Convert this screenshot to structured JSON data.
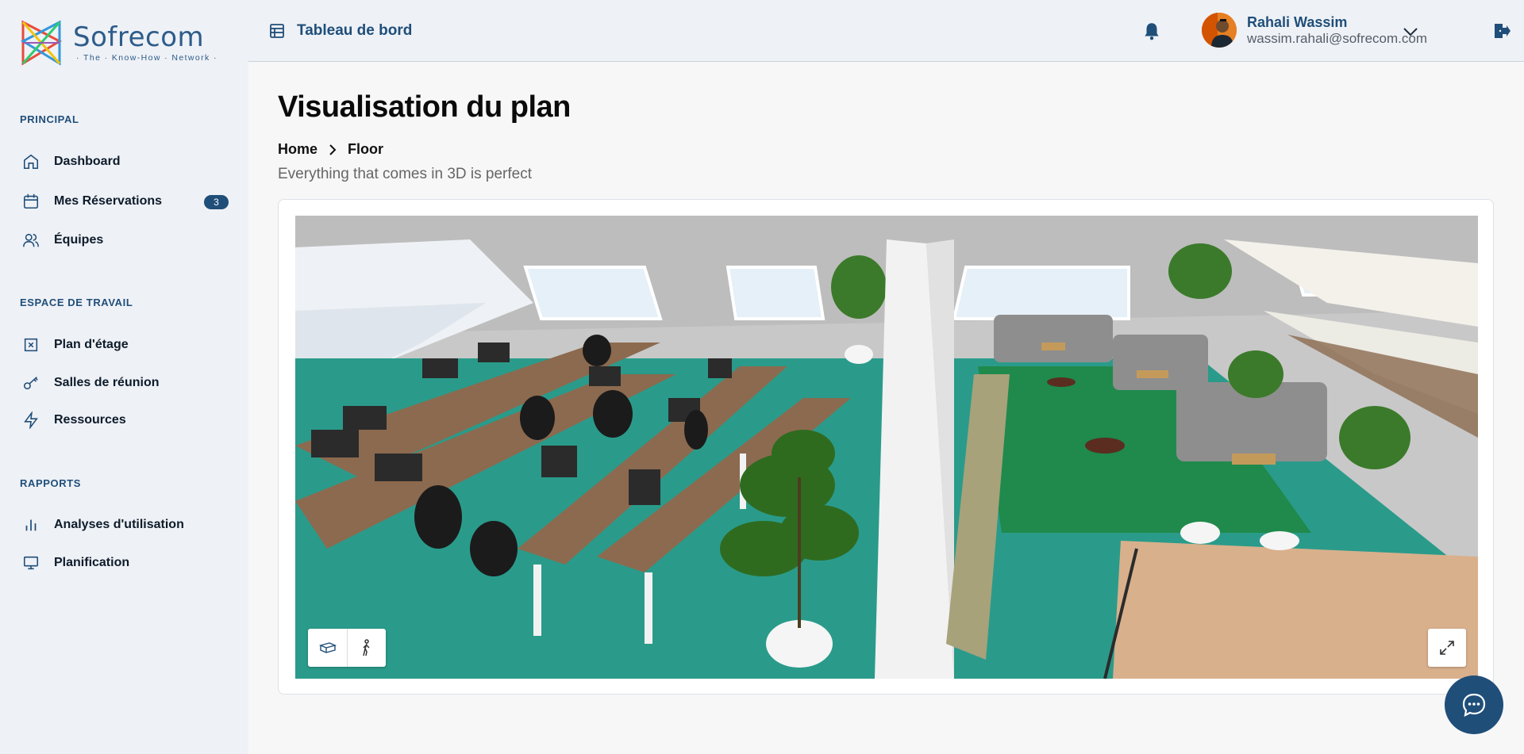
{
  "brand": {
    "name": "Sofrecom",
    "tagline": "· The · Know-How · Network ·"
  },
  "sidebar": {
    "sections": [
      {
        "title": "PRINCIPAL"
      },
      {
        "title": "ESPACE DE TRAVAIL"
      },
      {
        "title": "RAPPORTS"
      }
    ],
    "items": [
      {
        "label": "Dashboard",
        "icon": "home-icon"
      },
      {
        "label": "Mes Réservations",
        "icon": "calendar-icon",
        "badge": "3"
      },
      {
        "label": "Équipes",
        "icon": "users-icon"
      },
      {
        "label": "Plan d'étage",
        "icon": "floor-plan-icon"
      },
      {
        "label": "Salles de réunion",
        "icon": "key-icon"
      },
      {
        "label": "Ressources",
        "icon": "bolt-icon"
      },
      {
        "label": "Analyses d'utilisation",
        "icon": "bar-chart-icon"
      },
      {
        "label": "Planification",
        "icon": "monitor-icon"
      }
    ]
  },
  "header": {
    "title": "Tableau de bord",
    "user": {
      "name": "Rahali Wassim",
      "email": "wassim.rahali@sofrecom.com"
    }
  },
  "main": {
    "title": "Visualisation du plan",
    "breadcrumb": [
      "Home",
      "Floor"
    ],
    "subtitle": "Everything that comes in 3D is perfect"
  },
  "colors": {
    "primary": "#1f4e79",
    "sidebar_bg": "#eef1f6",
    "carpet": "#2a9b8a",
    "lounge_carpet": "#1f8a4c"
  }
}
